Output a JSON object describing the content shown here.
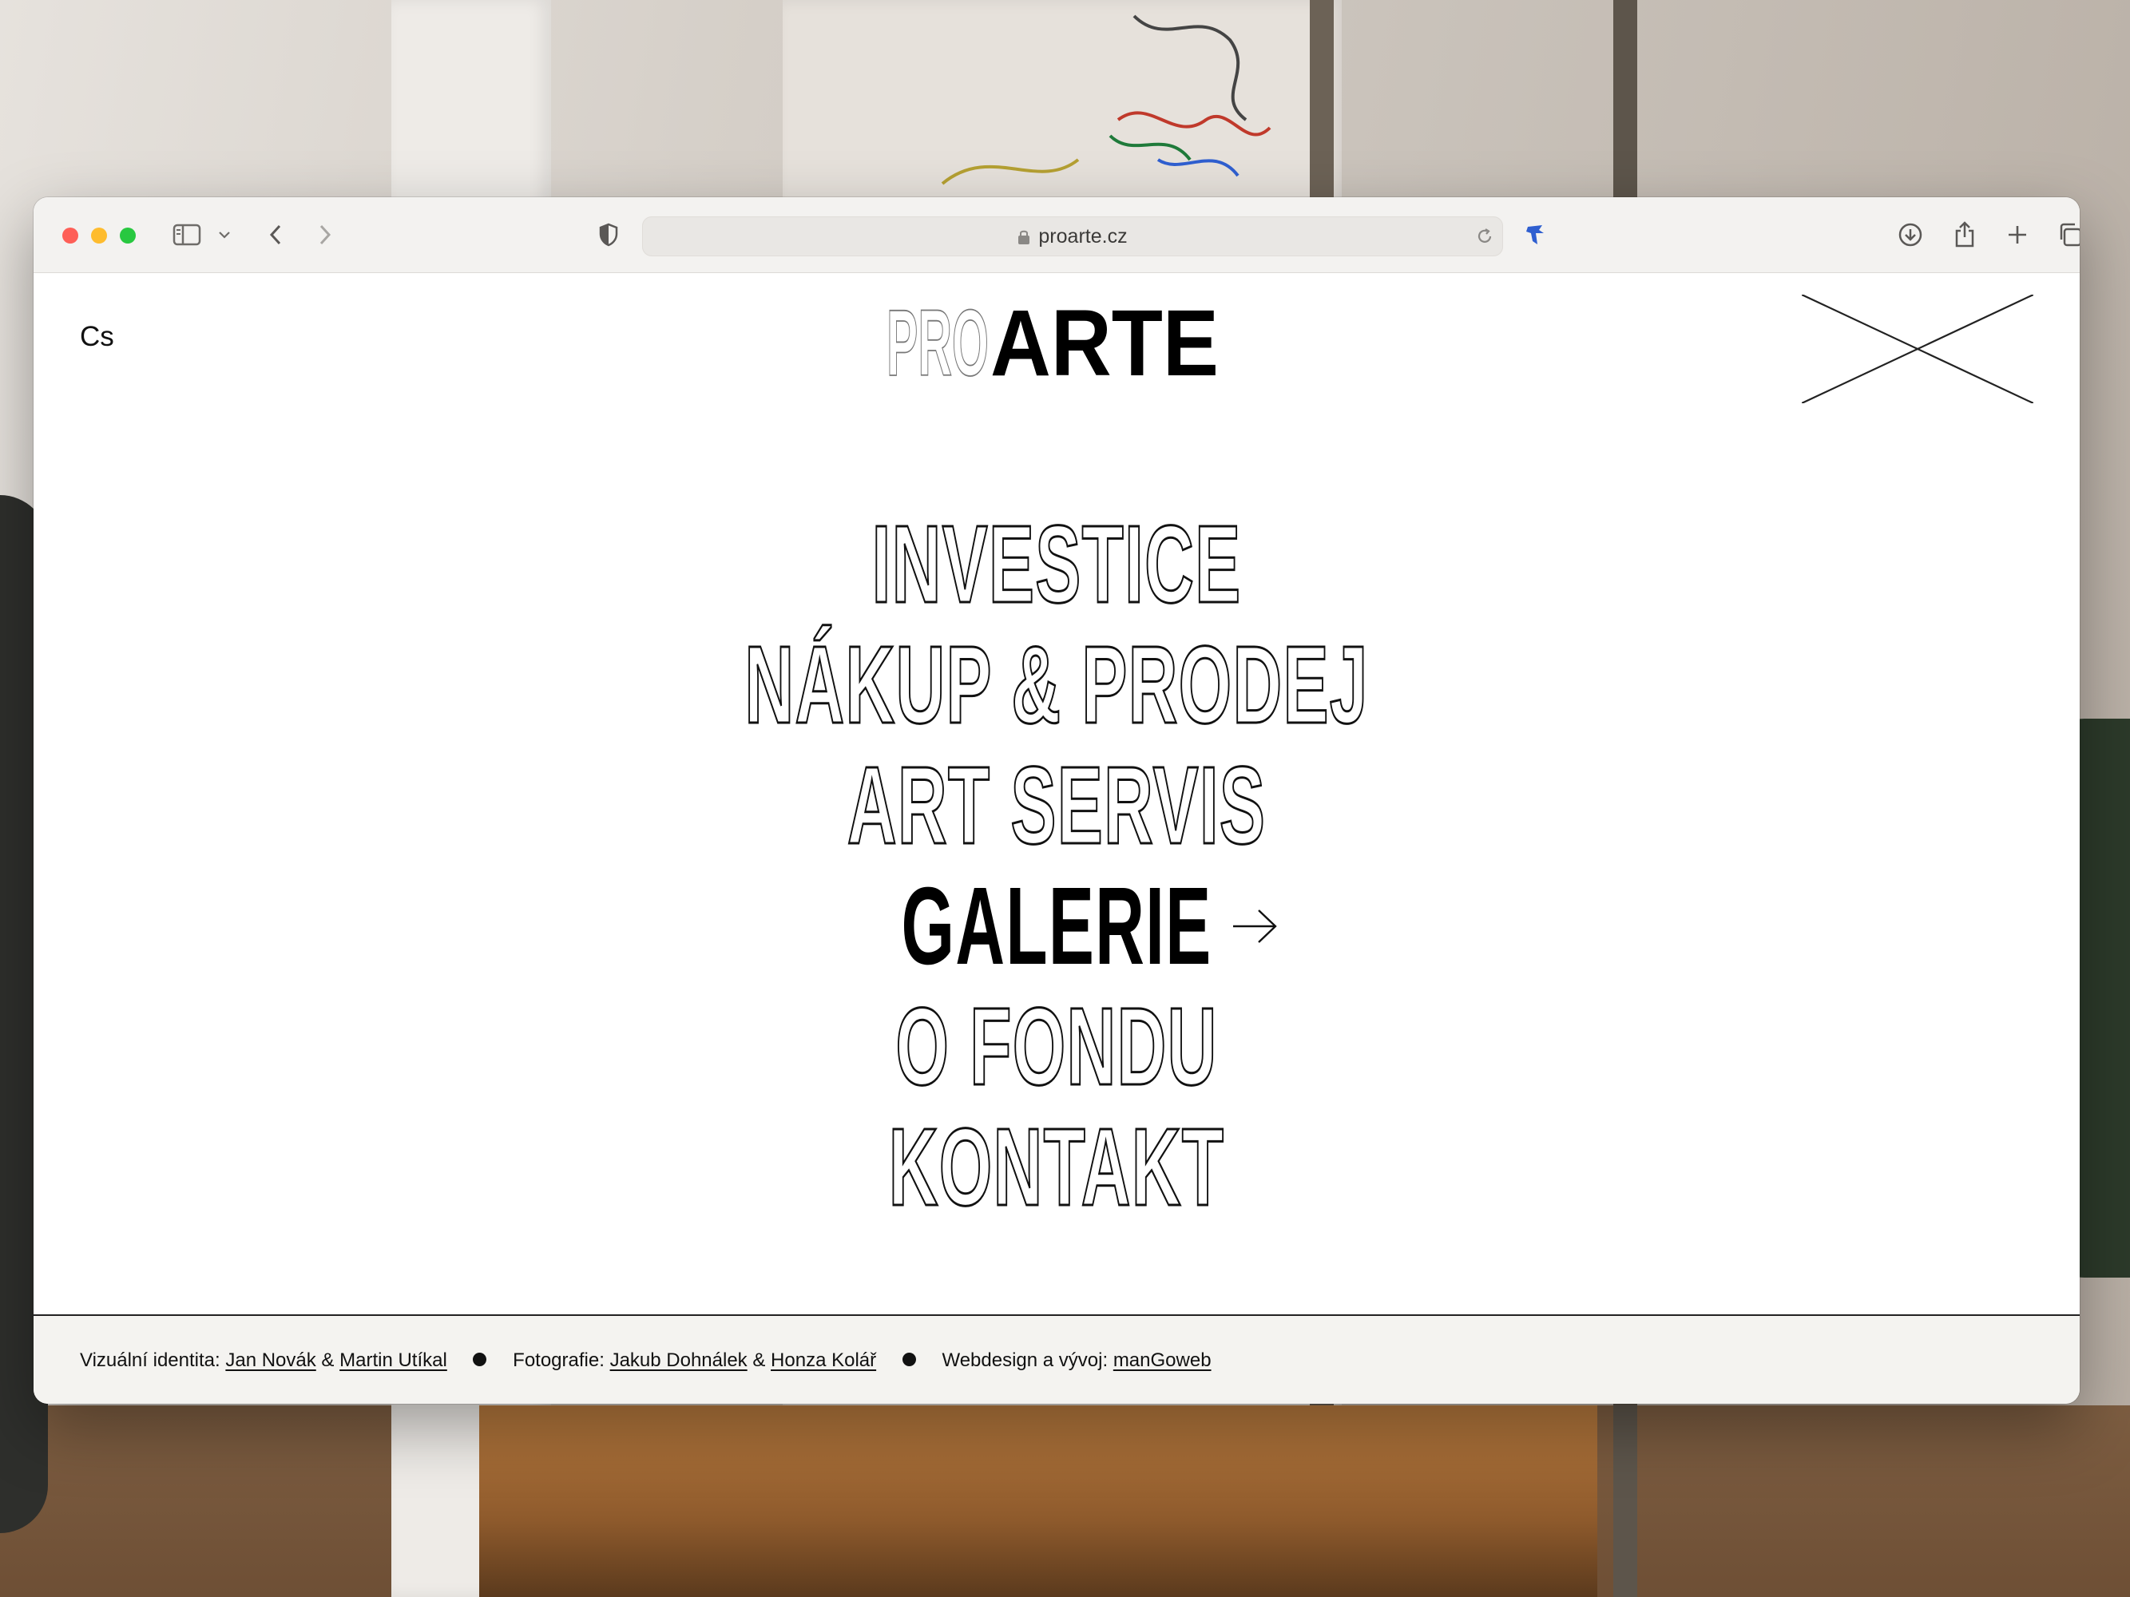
{
  "browser": {
    "url": "proarte.cz"
  },
  "site": {
    "language": "Cs",
    "logo": {
      "outline_part": "PRO",
      "solid_part": "ARTE"
    },
    "menu": [
      {
        "label": "INVESTICE",
        "active": false
      },
      {
        "label": "NÁKUP & PRODEJ",
        "active": false
      },
      {
        "label": "ART SERVIS",
        "active": false
      },
      {
        "label": "GALERIE",
        "active": true
      },
      {
        "label": "O FONDU",
        "active": false
      },
      {
        "label": "KONTAKT",
        "active": false
      }
    ],
    "active_arrow": "→"
  },
  "footer": {
    "identity_label": "Vizuální identita:",
    "identity_person_1": "Jan Novák",
    "amp": "&",
    "identity_person_2": "Martin Utíkal",
    "photo_label": "Fotografie:",
    "photo_person_1": "Jakub Dohnálek",
    "photo_person_2": "Honza Kolář",
    "web_label": "Webdesign a vývoj:",
    "web_person": "manGoweb"
  },
  "colors": {
    "traffic_red": "#fe5f57",
    "traffic_yellow": "#febc2e",
    "traffic_green": "#28c840",
    "extension_blue": "#2f5fd0",
    "ink": "#111111"
  },
  "icons": [
    "sidebar-icon",
    "chevron-down-icon",
    "back-icon",
    "forward-icon",
    "shield-icon",
    "lock-icon",
    "reload-icon",
    "extension-icon",
    "download-icon",
    "share-icon",
    "new-tab-icon",
    "tabs-overview-icon",
    "close-menu-icon",
    "arrow-right-icon"
  ]
}
